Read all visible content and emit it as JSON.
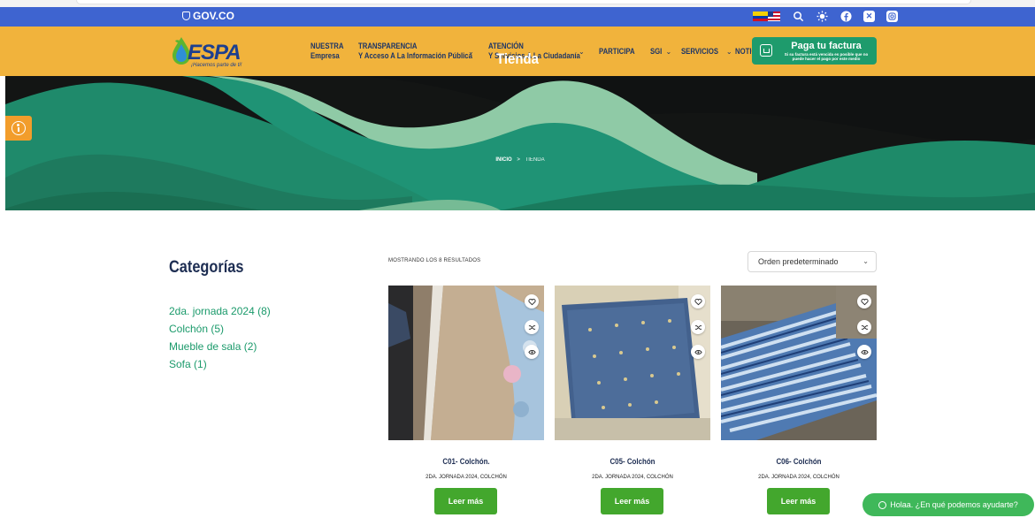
{
  "gov_bar": {
    "logo": "GOV.CO",
    "bg": "#3e64d0"
  },
  "nav": {
    "brand": {
      "word": "ESPA",
      "tagline": "¡Hacemos parte de ti!"
    },
    "items": [
      {
        "line1": "NUESTRA",
        "line2": "Empresa",
        "has_menu": false
      },
      {
        "line1": "TRANSPARENCIA",
        "line2": "Y Acceso A La Información Pública",
        "has_menu": true
      },
      {
        "line1": "ATENCIÓN",
        "line2": "Y Servicios A La Ciudadanía",
        "has_menu": true
      },
      {
        "line1": "PARTICIPA",
        "line2": "",
        "has_menu": false
      },
      {
        "line1": "SGI",
        "line2": "",
        "has_menu": true
      },
      {
        "line1": "SERVICIOS",
        "line2": "",
        "has_menu": true
      },
      {
        "line1": "NOTICIAS",
        "line2": "",
        "has_menu": false
      }
    ],
    "pay": {
      "title": "Paga tu factura",
      "subtitle": "Si su factura está vencida es posible que no puede hacer el pago por este medio"
    },
    "bg": "#f1b33c"
  },
  "hero": {
    "title": "Tienda",
    "breadcrumb": {
      "home": "INICIO",
      "separator": ">",
      "current": "TIENDA"
    }
  },
  "sidebar": {
    "title": "Categorías",
    "categories": [
      {
        "name": "2da. jornada 2024",
        "count": "(8)"
      },
      {
        "name": "Colchón",
        "count": "(5)"
      },
      {
        "name": "Mueble de sala",
        "count": "(2)"
      },
      {
        "name": "Sofa",
        "count": "(1)"
      }
    ]
  },
  "shop": {
    "result_count": "MOSTRANDO LOS 8 RESULTADOS",
    "sort": {
      "selected": "Orden predeterminado"
    },
    "products": [
      {
        "name": "C01- Colchón.",
        "categories": "2DA. JORNADA 2024, COLCHÓN",
        "button": "Leer más"
      },
      {
        "name": "C05- Colchón",
        "categories": "2DA. JORNADA 2024, COLCHÓN",
        "button": "Leer más"
      },
      {
        "name": "C06- Colchón",
        "categories": "2DA. JORNADA 2024, COLCHÓN",
        "button": "Leer más"
      }
    ]
  },
  "chat": {
    "label": "Holaa. ¿En qué podemos ayudarte?"
  },
  "colors": {
    "accent_green": "#1b9a6b",
    "button_green": "#43a72d",
    "navy": "#1d2d52"
  }
}
